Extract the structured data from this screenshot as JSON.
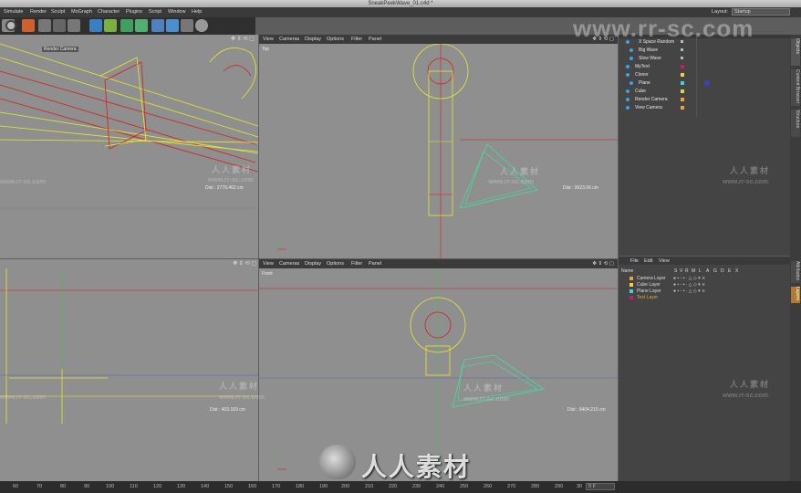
{
  "window": {
    "title": "SneakPeekWave_01.c4d *"
  },
  "menu": [
    "Simulate",
    "Render",
    "Sculpt",
    "MoGraph",
    "Character",
    "Plugins",
    "Script",
    "Window",
    "Help"
  ],
  "layout": {
    "label": "Layout:",
    "value": "Startup"
  },
  "viewport_menu": [
    "View",
    "Cameras",
    "Display",
    "Options",
    "Filter",
    "Panel"
  ],
  "viewports": {
    "perspective": {
      "camera_label": "Render Camera",
      "distance": "Dist : 2779.462 cm"
    },
    "top": {
      "label": "Top",
      "distance": "Dist : 9923.06 cm"
    },
    "right": {
      "distance": "Dist : 403.169 cm"
    },
    "front": {
      "label": "Front",
      "distance": "Dist : 9404.215 cm"
    }
  },
  "objects": [
    {
      "name": "X Space Random"
    },
    {
      "name": "Big Wave"
    },
    {
      "name": "Slow Wave"
    },
    {
      "name": "MyText"
    },
    {
      "name": "Cloner"
    },
    {
      "name": "Plane"
    },
    {
      "name": "Cube"
    },
    {
      "name": "Render Camera"
    },
    {
      "name": "View Camera"
    }
  ],
  "layer_menu": [
    "File",
    "Edit",
    "View"
  ],
  "layer_header": {
    "name": "Name",
    "cols": [
      "S",
      "V",
      "R",
      "M",
      "L",
      "A",
      "G",
      "D",
      "E",
      "X"
    ]
  },
  "layers": [
    {
      "name": "Camera Layer",
      "color": "#f0a040"
    },
    {
      "name": "Cube Layer",
      "color": "#f0d040"
    },
    {
      "name": "Plane Layer",
      "color": "#40d0e0"
    },
    {
      "name": "Text Layer",
      "color": "#c02060"
    }
  ],
  "side_tabs": [
    "Objects",
    "Content Browser",
    "Structure",
    "Attributes",
    "Layers"
  ],
  "timeline": {
    "ticks": [
      "60",
      "70",
      "80",
      "90",
      "100",
      "110",
      "120",
      "130",
      "140",
      "150",
      "160",
      "170",
      "180",
      "190",
      "200",
      "210",
      "220",
      "230",
      "240",
      "250",
      "260",
      "270",
      "280",
      "290",
      "30"
    ],
    "frame": "0 F"
  },
  "watermark": {
    "site": "www.rr-sc.com",
    "cn": "人人素材",
    "sub": "www.rr-sc.com"
  },
  "colors": {
    "wire_yellow": "#e8e830",
    "wire_red": "#d02020",
    "wire_green": "#40e0a0",
    "viewport_bg": "#8f8f8f"
  }
}
